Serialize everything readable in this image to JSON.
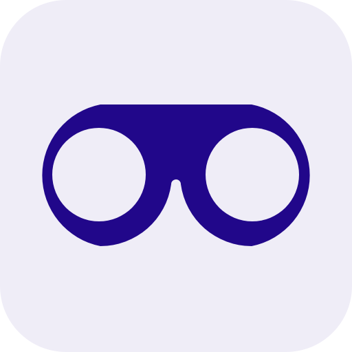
{
  "icon": {
    "name": "glasses-icon",
    "background_color": "#efedf7",
    "glyph_color": "#21078a"
  }
}
